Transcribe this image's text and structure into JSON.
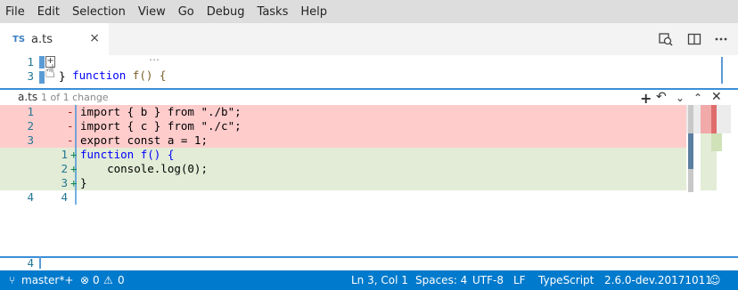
{
  "menu": [
    "File",
    "Edit",
    "Selection",
    "View",
    "Go",
    "Debug",
    "Tasks",
    "Help"
  ],
  "tab": {
    "lang_badge": "TS",
    "filename": "a.ts",
    "close": "×"
  },
  "editor": {
    "line1_num": "1",
    "line1_code": "function f() {",
    "fold_marker": "⋯",
    "line3_num": "3",
    "line3_code": "}",
    "bottom_line_num": "4"
  },
  "diff_header": {
    "filename": "a.ts",
    "summary": "1 of 1 change"
  },
  "diff": {
    "removed": [
      {
        "num": "1",
        "marker": "-",
        "code": "import { b } from \"./b\";"
      },
      {
        "num": "2",
        "marker": "-",
        "code": "import { c } from \"./c\";"
      },
      {
        "num": "3",
        "marker": "-",
        "code": "export const a = 1;"
      }
    ],
    "added": [
      {
        "num": "1",
        "marker": "+",
        "code": "function f() {"
      },
      {
        "num": "2",
        "marker": "+",
        "code": "    console.log(0);"
      },
      {
        "num": "3",
        "marker": "+",
        "code": "}"
      }
    ],
    "unchanged": {
      "old_num": "4",
      "new_num": "4"
    }
  },
  "statusbar": {
    "branch": "master*+",
    "errors": "0",
    "warnings": "0",
    "position": "Ln 3, Col 1",
    "spaces": "Spaces: 4",
    "encoding": "UTF-8",
    "eol": "LF",
    "language": "TypeScript",
    "version": "2.6.0-dev.20171011"
  },
  "colors": {
    "accent": "#007acc",
    "deleted_bg": "#ffcccc",
    "added_bg": "#e2ecd6"
  }
}
